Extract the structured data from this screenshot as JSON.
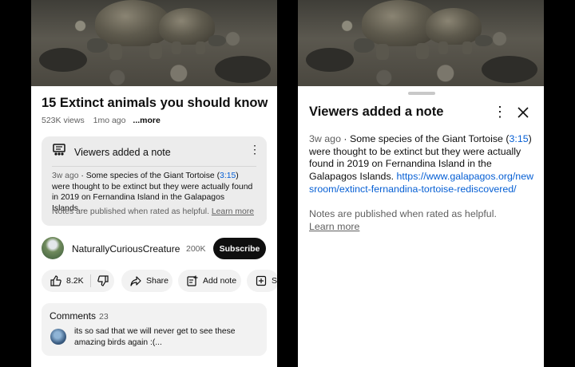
{
  "video": {
    "title": "15 Extinct animals you should know",
    "views": "523K views",
    "age": "1mo ago",
    "more_label": "...more"
  },
  "note_card": {
    "heading": "Viewers added a note",
    "time": "3w ago",
    "text_before": " · Some species of the Giant Tortoise (",
    "timestamp": "3:15",
    "text_after": ") were thought to be extinct but they were actually found in 2019 on Fernandina Island in the Galapagos Islands...",
    "footer": "Notes are published when rated as helpful.",
    "learn_more": "Learn more"
  },
  "channel": {
    "name": "NaturallyCuriousCreature",
    "subscribers": "200K",
    "subscribe_label": "Subscribe"
  },
  "actions": {
    "likes": "8.2K",
    "share": "Share",
    "add_note": "Add note",
    "save": "Sa"
  },
  "comments": {
    "title": "Comments",
    "count": "23",
    "top_comment": "its so sad that we will never get to see these amazing birds again :(..."
  },
  "sheet": {
    "title": "Viewers added a note",
    "time": "3w ago",
    "text_before": " · Some species of the Giant Tortoise (",
    "timestamp": "3:15",
    "text_after": ") were thought to be extinct but they were actually found in 2019 on Fernandina Island in the Galapagos Islands. ",
    "link": "https://www.galapagos.org/newsroom/extinct-fernandina-tortoise-rediscovered/",
    "footer": "Notes are published when rated as helpful.",
    "learn_more": "Learn more"
  },
  "colors": {
    "link": "#065fd4",
    "muted_text": "#606060",
    "card_background": "#ececec",
    "subscribe_button": "#0f0f0f"
  },
  "icons": [
    "notes-icon",
    "more-vert-icon",
    "thumb-up-icon",
    "thumb-down-icon",
    "share-icon",
    "add-note-icon",
    "save-icon",
    "close-icon"
  ]
}
